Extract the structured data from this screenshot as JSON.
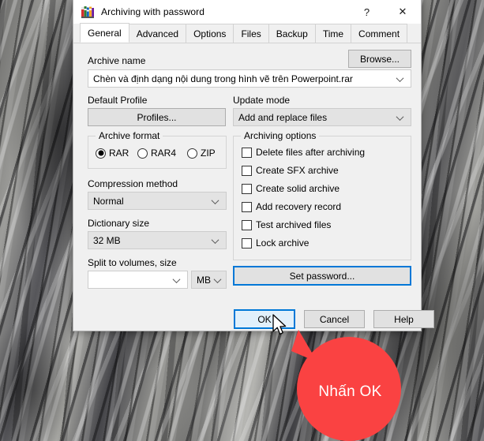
{
  "window": {
    "title": "Archiving with password",
    "icon": "winrar-books-icon",
    "help_button": "?",
    "close_button": "✕"
  },
  "tabs": [
    {
      "label": "General",
      "active": true
    },
    {
      "label": "Advanced",
      "active": false
    },
    {
      "label": "Options",
      "active": false
    },
    {
      "label": "Files",
      "active": false
    },
    {
      "label": "Backup",
      "active": false
    },
    {
      "label": "Time",
      "active": false
    },
    {
      "label": "Comment",
      "active": false
    }
  ],
  "archive_name": {
    "label": "Archive name",
    "value": "Chèn và định dạng nội dung trong hình vẽ trên Powerpoint.rar",
    "browse_label": "Browse..."
  },
  "default_profile": {
    "label": "Default Profile",
    "button_label": "Profiles..."
  },
  "update_mode": {
    "label": "Update mode",
    "value": "Add and replace files"
  },
  "archive_format": {
    "legend": "Archive format",
    "options": [
      {
        "label": "RAR",
        "selected": true
      },
      {
        "label": "RAR4",
        "selected": false
      },
      {
        "label": "ZIP",
        "selected": false
      }
    ]
  },
  "compression_method": {
    "label": "Compression method",
    "value": "Normal"
  },
  "dictionary_size": {
    "label": "Dictionary size",
    "value": "32 MB"
  },
  "split_volumes": {
    "label": "Split to volumes, size",
    "value": "",
    "unit": "MB"
  },
  "archiving_options": {
    "legend": "Archiving options",
    "items": [
      {
        "label": "Delete files after archiving",
        "checked": false
      },
      {
        "label": "Create SFX archive",
        "checked": false
      },
      {
        "label": "Create solid archive",
        "checked": false
      },
      {
        "label": "Add recovery record",
        "checked": false
      },
      {
        "label": "Test archived files",
        "checked": false
      },
      {
        "label": "Lock archive",
        "checked": false
      }
    ]
  },
  "set_password": {
    "label": "Set password..."
  },
  "footer": {
    "ok_label": "OK",
    "cancel_label": "Cancel",
    "help_label": "Help"
  },
  "annotation": {
    "text": "Nhấn OK",
    "color": "#fa4242",
    "text_color": "#ffffff"
  },
  "colors": {
    "accent": "#0078d7",
    "dialog_bg": "#f0f0f0",
    "titlebar_bg": "#ffffff",
    "control_bg": "#e1e1e1",
    "combo_bg": "#e3e3e3"
  }
}
